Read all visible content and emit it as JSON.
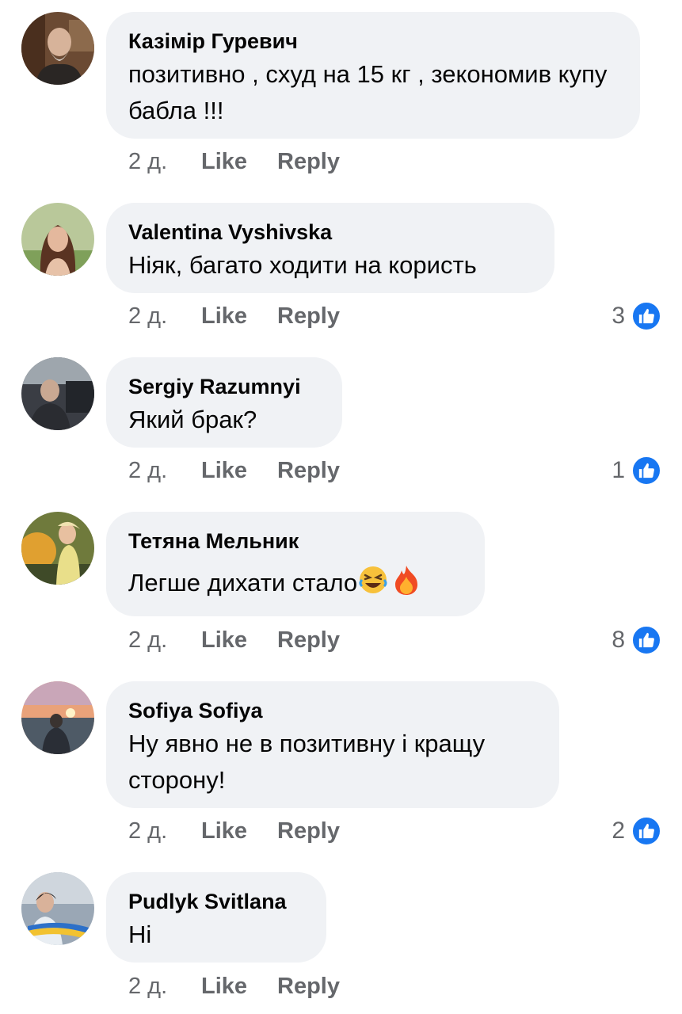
{
  "accent_color": "#1877f2",
  "bubble_color": "#f0f2f5",
  "comments": [
    {
      "author": "Казімір Гуревич",
      "text": "позитивно , схуд на 15 кг , зекономив купу бабла !!!",
      "time": "2 д.",
      "like_label": "Like",
      "reply_label": "Reply",
      "reaction_count": ""
    },
    {
      "author": "Valentina Vyshivska",
      "text": "Ніяк, багато ходити на користь",
      "time": "2 д.",
      "like_label": "Like",
      "reply_label": "Reply",
      "reaction_count": "3",
      "reaction_icon": "thumbs-up-icon"
    },
    {
      "author": "Sergiy Razumnyi",
      "text": "Який брак?",
      "time": "2 д.",
      "like_label": "Like",
      "reply_label": "Reply",
      "reaction_count": "1",
      "reaction_icon": "thumbs-up-icon"
    },
    {
      "author": "Тетяна Мельник",
      "text": "Легше дихати стало",
      "emojis": [
        "rolling-laughing-emoji",
        "fire-emoji"
      ],
      "time": "2 д.",
      "like_label": "Like",
      "reply_label": "Reply",
      "reaction_count": "8",
      "reaction_icon": "thumbs-up-icon"
    },
    {
      "author": "Sofiya Sofiya",
      "text": "Ну явно не в позитивну і кращу сторону!",
      "time": "2 д.",
      "like_label": "Like",
      "reply_label": "Reply",
      "reaction_count": "2",
      "reaction_icon": "thumbs-up-icon"
    },
    {
      "author": "Pudlyk Svitlana",
      "text": "Ні",
      "time": "2 д.",
      "like_label": "Like",
      "reply_label": "Reply",
      "reaction_count": ""
    }
  ]
}
